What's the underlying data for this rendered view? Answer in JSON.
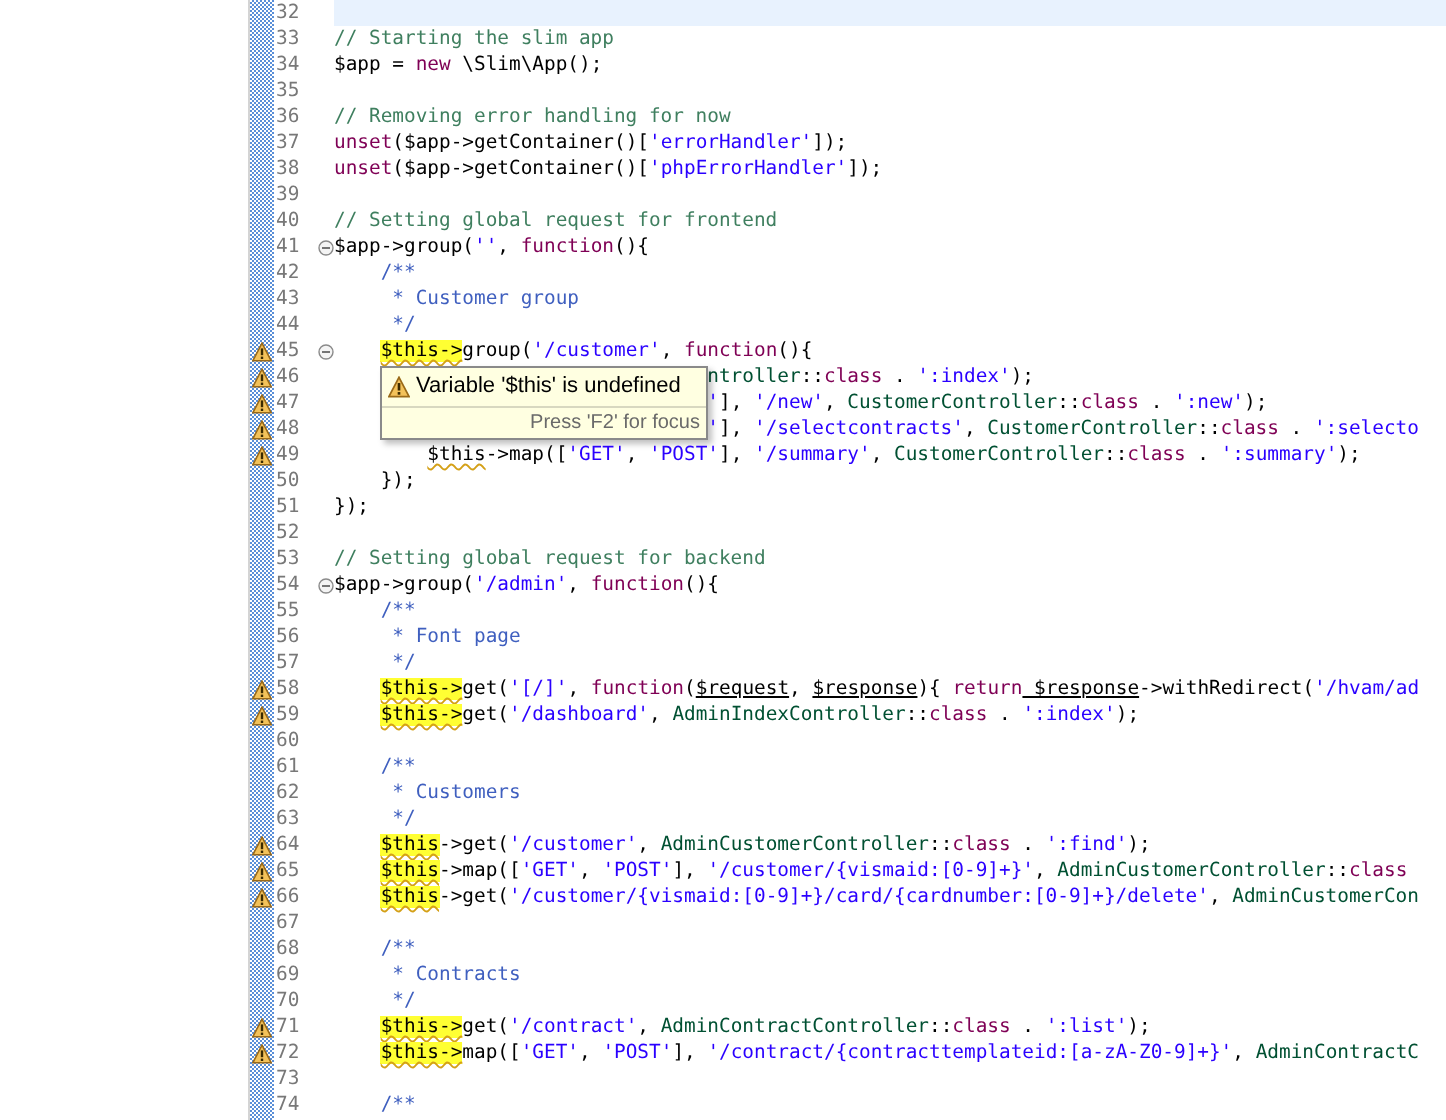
{
  "editor": {
    "lines": [
      {
        "number": "32",
        "current": true,
        "warning": false,
        "fold": false
      },
      {
        "number": "33",
        "current": false,
        "warning": false,
        "fold": false,
        "segments": [
          {
            "kind": "comment",
            "text": "// Starting the slim app"
          }
        ]
      },
      {
        "number": "34",
        "current": false,
        "warning": false,
        "fold": false,
        "segments": [
          {
            "kind": "plain",
            "text": "$app = "
          },
          {
            "kind": "keyword",
            "text": "new"
          },
          {
            "kind": "plain",
            "text": " \\Slim\\App();"
          }
        ]
      },
      {
        "number": "35",
        "current": false,
        "warning": false,
        "fold": false
      },
      {
        "number": "36",
        "current": false,
        "warning": false,
        "fold": false,
        "segments": [
          {
            "kind": "comment",
            "text": "// Removing error handling for now"
          }
        ]
      },
      {
        "number": "37",
        "current": false,
        "warning": false,
        "fold": false,
        "segments": [
          {
            "kind": "keyword",
            "text": "unset"
          },
          {
            "kind": "plain",
            "text": "($app->getContainer()["
          },
          {
            "kind": "string",
            "text": "'errorHandler'"
          },
          {
            "kind": "plain",
            "text": "]);"
          }
        ]
      },
      {
        "number": "38",
        "current": false,
        "warning": false,
        "fold": false,
        "segments": [
          {
            "kind": "keyword",
            "text": "unset"
          },
          {
            "kind": "plain",
            "text": "($app->getContainer()["
          },
          {
            "kind": "string",
            "text": "'phpErrorHandler'"
          },
          {
            "kind": "plain",
            "text": "]);"
          }
        ]
      },
      {
        "number": "39",
        "current": false,
        "warning": false,
        "fold": false
      },
      {
        "number": "40",
        "current": false,
        "warning": false,
        "fold": false,
        "segments": [
          {
            "kind": "comment",
            "text": "// Setting global request for frontend"
          }
        ]
      },
      {
        "number": "41",
        "current": false,
        "warning": false,
        "fold": true,
        "segments": [
          {
            "kind": "plain",
            "text": "$app->group("
          },
          {
            "kind": "string",
            "text": "''"
          },
          {
            "kind": "plain",
            "text": ", "
          },
          {
            "kind": "keyword",
            "text": "function"
          },
          {
            "kind": "plain",
            "text": "(){"
          }
        ]
      },
      {
        "number": "42",
        "current": false,
        "warning": false,
        "fold": false,
        "segments": [
          {
            "kind": "doc",
            "text": "    /**"
          }
        ]
      },
      {
        "number": "43",
        "current": false,
        "warning": false,
        "fold": false,
        "segments": [
          {
            "kind": "doc",
            "text": "     * Customer group"
          }
        ]
      },
      {
        "number": "44",
        "current": false,
        "warning": false,
        "fold": false,
        "segments": [
          {
            "kind": "doc",
            "text": "     */"
          }
        ]
      },
      {
        "number": "45",
        "current": false,
        "warning": true,
        "fold": true,
        "segments": [
          {
            "kind": "highlight",
            "text": "    $this->"
          },
          {
            "kind": "plain",
            "text": "group("
          },
          {
            "kind": "string",
            "text": "'/customer'"
          },
          {
            "kind": "plain",
            "text": ", "
          },
          {
            "kind": "keyword",
            "text": "function"
          },
          {
            "kind": "plain",
            "text": "(){"
          }
        ]
      },
      {
        "number": "46",
        "current": false,
        "warning": true,
        "fold": false,
        "segments": [
          {
            "kind": "type",
            "text": "                                ntroller"
          },
          {
            "kind": "plain",
            "text": "::"
          },
          {
            "kind": "keyword",
            "text": "class"
          },
          {
            "kind": "plain",
            "text": " . "
          },
          {
            "kind": "string",
            "text": "':index'"
          },
          {
            "kind": "plain",
            "text": ");"
          }
        ]
      },
      {
        "number": "47",
        "current": false,
        "warning": true,
        "fold": false,
        "segments": [
          {
            "kind": "string",
            "text": "                                '"
          },
          {
            "kind": "plain",
            "text": "], "
          },
          {
            "kind": "string",
            "text": "'/new'"
          },
          {
            "kind": "plain",
            "text": ", "
          },
          {
            "kind": "type",
            "text": "CustomerController"
          },
          {
            "kind": "plain",
            "text": "::"
          },
          {
            "kind": "keyword",
            "text": "class"
          },
          {
            "kind": "plain",
            "text": " . "
          },
          {
            "kind": "string",
            "text": "':new'"
          },
          {
            "kind": "plain",
            "text": ");"
          }
        ]
      },
      {
        "number": "48",
        "current": false,
        "warning": true,
        "fold": false,
        "segments": [
          {
            "kind": "string",
            "text": "                                '"
          },
          {
            "kind": "plain",
            "text": "], "
          },
          {
            "kind": "string",
            "text": "'/selectcontracts'"
          },
          {
            "kind": "plain",
            "text": ", "
          },
          {
            "kind": "type",
            "text": "CustomerController"
          },
          {
            "kind": "plain",
            "text": "::"
          },
          {
            "kind": "keyword",
            "text": "class"
          },
          {
            "kind": "plain",
            "text": " . "
          },
          {
            "kind": "string",
            "text": "':selecto"
          }
        ]
      },
      {
        "number": "49",
        "current": false,
        "warning": true,
        "fold": false,
        "segments": [
          {
            "kind": "squiggle",
            "text": "        $this"
          },
          {
            "kind": "plain",
            "text": "->map(["
          },
          {
            "kind": "string",
            "text": "'GET'"
          },
          {
            "kind": "plain",
            "text": ", "
          },
          {
            "kind": "string",
            "text": "'POST'"
          },
          {
            "kind": "plain",
            "text": "], "
          },
          {
            "kind": "string",
            "text": "'/summary'"
          },
          {
            "kind": "plain",
            "text": ", "
          },
          {
            "kind": "type",
            "text": "CustomerController"
          },
          {
            "kind": "plain",
            "text": "::"
          },
          {
            "kind": "keyword",
            "text": "class"
          },
          {
            "kind": "plain",
            "text": " . "
          },
          {
            "kind": "string",
            "text": "':summary'"
          },
          {
            "kind": "plain",
            "text": ");"
          }
        ]
      },
      {
        "number": "50",
        "current": false,
        "warning": false,
        "fold": false,
        "segments": [
          {
            "kind": "plain",
            "text": "    });"
          }
        ]
      },
      {
        "number": "51",
        "current": false,
        "warning": false,
        "fold": false,
        "segments": [
          {
            "kind": "plain",
            "text": "});"
          }
        ]
      },
      {
        "number": "52",
        "current": false,
        "warning": false,
        "fold": false
      },
      {
        "number": "53",
        "current": false,
        "warning": false,
        "fold": false,
        "segments": [
          {
            "kind": "comment",
            "text": "// Setting global request for backend"
          }
        ]
      },
      {
        "number": "54",
        "current": false,
        "warning": false,
        "fold": true,
        "segments": [
          {
            "kind": "plain",
            "text": "$app->group("
          },
          {
            "kind": "string",
            "text": "'/admin'"
          },
          {
            "kind": "plain",
            "text": ", "
          },
          {
            "kind": "keyword",
            "text": "function"
          },
          {
            "kind": "plain",
            "text": "(){"
          }
        ]
      },
      {
        "number": "55",
        "current": false,
        "warning": false,
        "fold": false,
        "segments": [
          {
            "kind": "doc",
            "text": "    /**"
          }
        ]
      },
      {
        "number": "56",
        "current": false,
        "warning": false,
        "fold": false,
        "segments": [
          {
            "kind": "doc",
            "text": "     * Font page"
          }
        ]
      },
      {
        "number": "57",
        "current": false,
        "warning": false,
        "fold": false,
        "segments": [
          {
            "kind": "doc",
            "text": "     */"
          }
        ]
      },
      {
        "number": "58",
        "current": false,
        "warning": true,
        "fold": false,
        "segments": [
          {
            "kind": "highlight",
            "text": "    $this->"
          },
          {
            "kind": "plain",
            "text": "get("
          },
          {
            "kind": "string",
            "text": "'[/]'"
          },
          {
            "kind": "plain",
            "text": ", "
          },
          {
            "kind": "keyword",
            "text": "function"
          },
          {
            "kind": "plain",
            "text": "("
          },
          {
            "kind": "variable",
            "text": "$request"
          },
          {
            "kind": "plain",
            "text": ", "
          },
          {
            "kind": "variable",
            "text": "$response"
          },
          {
            "kind": "plain",
            "text": "){ "
          },
          {
            "kind": "keyword",
            "text": "return"
          },
          {
            "kind": "variable",
            "text": " $response"
          },
          {
            "kind": "plain",
            "text": "->withRedirect("
          },
          {
            "kind": "string",
            "text": "'/hvam/ad"
          }
        ]
      },
      {
        "number": "59",
        "current": false,
        "warning": true,
        "fold": false,
        "segments": [
          {
            "kind": "highlight",
            "text": "    $this->"
          },
          {
            "kind": "plain",
            "text": "get("
          },
          {
            "kind": "string",
            "text": "'/dashboard'"
          },
          {
            "kind": "plain",
            "text": ", "
          },
          {
            "kind": "type",
            "text": "AdminIndexController"
          },
          {
            "kind": "plain",
            "text": "::"
          },
          {
            "kind": "keyword",
            "text": "class"
          },
          {
            "kind": "plain",
            "text": " . "
          },
          {
            "kind": "string",
            "text": "':index'"
          },
          {
            "kind": "plain",
            "text": ");"
          }
        ]
      },
      {
        "number": "60",
        "current": false,
        "warning": false,
        "fold": false
      },
      {
        "number": "61",
        "current": false,
        "warning": false,
        "fold": false,
        "segments": [
          {
            "kind": "doc",
            "text": "    /**"
          }
        ]
      },
      {
        "number": "62",
        "current": false,
        "warning": false,
        "fold": false,
        "segments": [
          {
            "kind": "doc",
            "text": "     * Customers"
          }
        ]
      },
      {
        "number": "63",
        "current": false,
        "warning": false,
        "fold": false,
        "segments": [
          {
            "kind": "doc",
            "text": "     */"
          }
        ]
      },
      {
        "number": "64",
        "current": false,
        "warning": true,
        "fold": false,
        "segments": [
          {
            "kind": "highlight",
            "text": "    $this"
          },
          {
            "kind": "plain",
            "text": "->get("
          },
          {
            "kind": "string",
            "text": "'/customer'"
          },
          {
            "kind": "plain",
            "text": ", "
          },
          {
            "kind": "type",
            "text": "AdminCustomerController"
          },
          {
            "kind": "plain",
            "text": "::"
          },
          {
            "kind": "keyword",
            "text": "class"
          },
          {
            "kind": "plain",
            "text": " . "
          },
          {
            "kind": "string",
            "text": "':find'"
          },
          {
            "kind": "plain",
            "text": ");"
          }
        ]
      },
      {
        "number": "65",
        "current": false,
        "warning": true,
        "fold": false,
        "segments": [
          {
            "kind": "highlight",
            "text": "    $this"
          },
          {
            "kind": "plain",
            "text": "->map(["
          },
          {
            "kind": "string",
            "text": "'GET'"
          },
          {
            "kind": "plain",
            "text": ", "
          },
          {
            "kind": "string",
            "text": "'POST'"
          },
          {
            "kind": "plain",
            "text": "], "
          },
          {
            "kind": "string",
            "text": "'/customer/{vismaid:[0-9]+}'"
          },
          {
            "kind": "plain",
            "text": ", "
          },
          {
            "kind": "type",
            "text": "AdminCustomerController"
          },
          {
            "kind": "plain",
            "text": "::"
          },
          {
            "kind": "keyword",
            "text": "class"
          }
        ]
      },
      {
        "number": "66",
        "current": false,
        "warning": true,
        "fold": false,
        "segments": [
          {
            "kind": "highlight",
            "text": "    $this"
          },
          {
            "kind": "plain",
            "text": "->get("
          },
          {
            "kind": "string",
            "text": "'/customer/{vismaid:[0-9]+}/card/{cardnumber:[0-9]+}/delete'"
          },
          {
            "kind": "plain",
            "text": ", "
          },
          {
            "kind": "type",
            "text": "AdminCustomerCon"
          }
        ]
      },
      {
        "number": "67",
        "current": false,
        "warning": false,
        "fold": false
      },
      {
        "number": "68",
        "current": false,
        "warning": false,
        "fold": false,
        "segments": [
          {
            "kind": "doc",
            "text": "    /**"
          }
        ]
      },
      {
        "number": "69",
        "current": false,
        "warning": false,
        "fold": false,
        "segments": [
          {
            "kind": "doc",
            "text": "     * Contracts"
          }
        ]
      },
      {
        "number": "70",
        "current": false,
        "warning": false,
        "fold": false,
        "segments": [
          {
            "kind": "doc",
            "text": "     */"
          }
        ]
      },
      {
        "number": "71",
        "current": false,
        "warning": true,
        "fold": false,
        "segments": [
          {
            "kind": "highlight",
            "text": "    $this->"
          },
          {
            "kind": "plain",
            "text": "get("
          },
          {
            "kind": "string",
            "text": "'/contract'"
          },
          {
            "kind": "plain",
            "text": ", "
          },
          {
            "kind": "type",
            "text": "AdminContractController"
          },
          {
            "kind": "plain",
            "text": "::"
          },
          {
            "kind": "keyword",
            "text": "class"
          },
          {
            "kind": "plain",
            "text": " . "
          },
          {
            "kind": "string",
            "text": "':list'"
          },
          {
            "kind": "plain",
            "text": ");"
          }
        ]
      },
      {
        "number": "72",
        "current": false,
        "warning": true,
        "fold": false,
        "segments": [
          {
            "kind": "highlight",
            "text": "    $this->"
          },
          {
            "kind": "plain",
            "text": "map(["
          },
          {
            "kind": "string",
            "text": "'GET'"
          },
          {
            "kind": "plain",
            "text": ", "
          },
          {
            "kind": "string",
            "text": "'POST'"
          },
          {
            "kind": "plain",
            "text": "], "
          },
          {
            "kind": "string",
            "text": "'/contract/{contracttemplateid:[a-zA-Z0-9]+}'"
          },
          {
            "kind": "plain",
            "text": ", "
          },
          {
            "kind": "type",
            "text": "AdminContractC"
          }
        ]
      },
      {
        "number": "73",
        "current": false,
        "warning": false,
        "fold": false
      },
      {
        "number": "74",
        "current": false,
        "warning": false,
        "fold": false,
        "segments": [
          {
            "kind": "doc",
            "text": "    /**"
          }
        ]
      }
    ]
  },
  "tooltip": {
    "message": "Variable '$this' is undefined",
    "hint": "Press 'F2' for focus"
  }
}
